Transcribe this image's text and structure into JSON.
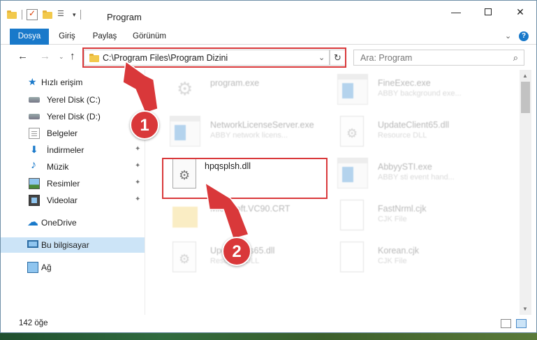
{
  "window": {
    "title": "Program",
    "controls": {
      "minimize": "—",
      "maximize": "",
      "close": "✕"
    }
  },
  "ribbon": {
    "tabs": [
      {
        "label": "Dosya",
        "active": true
      },
      {
        "label": "Giriş"
      },
      {
        "label": "Paylaş"
      },
      {
        "label": "Görünüm"
      }
    ],
    "chevron": "⌄",
    "help": "?"
  },
  "navigation": {
    "back": "←",
    "forward": "→",
    "recent": "⌄",
    "up": "↑",
    "address_path": "C:\\Program Files\\Program Dizini",
    "address_dropdown": "⌄",
    "refresh": "↻",
    "search_placeholder": "Ara: Program",
    "search_icon": "⌕"
  },
  "sidebar": {
    "items": [
      {
        "label": "Hızlı erişim",
        "icon": "star-icon"
      },
      {
        "label": "Yerel Disk (C:)",
        "icon": "disk-icon"
      },
      {
        "label": "Yerel Disk (D:)",
        "icon": "disk-icon"
      },
      {
        "label": "Belgeler",
        "icon": "documents-icon"
      },
      {
        "label": "İndirmeler",
        "icon": "downloads-icon",
        "pinned": true
      },
      {
        "label": "Müzik",
        "icon": "music-icon",
        "pinned": true
      },
      {
        "label": "Resimler",
        "icon": "pictures-icon",
        "pinned": true
      },
      {
        "label": "Videolar",
        "icon": "videos-icon",
        "pinned": true
      },
      {
        "label": "OneDrive",
        "icon": "cloud-icon"
      },
      {
        "label": "Bu bilgisayar",
        "icon": "computer-icon",
        "selected": true
      },
      {
        "label": "Ağ",
        "icon": "network-icon"
      }
    ],
    "pin_glyph": "📌"
  },
  "files": [
    {
      "name": "program.exe",
      "desc": "",
      "type": "gear"
    },
    {
      "name": "FineExec.exe",
      "desc": "ABBY background exe...",
      "type": "exe"
    },
    {
      "name": "NetworkLicenseServer.exe",
      "desc": "ABBY network licens...",
      "type": "exe"
    },
    {
      "name": "UpdateClient65.dll",
      "desc": "Resource DLL",
      "type": "dll"
    },
    {
      "name": "hpqsplsh.dll",
      "desc": "",
      "type": "dll",
      "highlighted": true
    },
    {
      "name": "AbbyySTI.exe",
      "desc": "ABBY sti event hand...",
      "type": "exe"
    },
    {
      "name": "Microsoft.VC90.CRT",
      "desc": "",
      "type": "folder"
    },
    {
      "name": "FastNrml.cjk",
      "desc": "CJK File",
      "type": "doc"
    },
    {
      "name": "UpdateRes65.dll",
      "desc": "Resource DLL",
      "type": "dll"
    },
    {
      "name": "Korean.cjk",
      "desc": "CJK File",
      "type": "doc"
    }
  ],
  "status": {
    "count": "142 öğe"
  },
  "callouts": {
    "first": "1",
    "second": "2"
  },
  "colors": {
    "accent": "#1979ca",
    "highlight": "#d9383a",
    "selection": "#cce4f7"
  }
}
